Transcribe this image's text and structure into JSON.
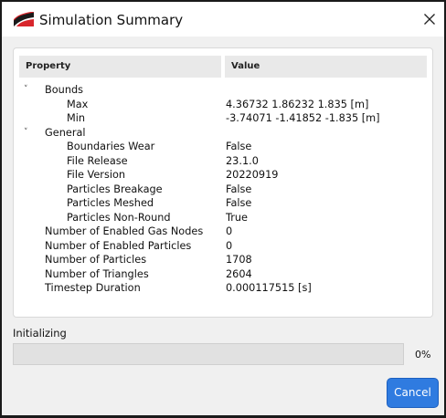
{
  "window": {
    "title": "Simulation Summary",
    "app_icon": "ansys-rocky-logo-icon",
    "close_icon": "close-icon"
  },
  "table": {
    "columns": [
      "Property",
      "Value"
    ],
    "rows": [
      {
        "level": 0,
        "expander": "chevron-down-icon",
        "property": "Bounds",
        "value": ""
      },
      {
        "level": 1,
        "property": "Max",
        "value": "4.36732 1.86232 1.835 [m]"
      },
      {
        "level": 1,
        "property": "Min",
        "value": "-3.74071 -1.41852 -1.835 [m]"
      },
      {
        "level": 0,
        "expander": "chevron-down-icon",
        "property": "General",
        "value": ""
      },
      {
        "level": 1,
        "property": "Boundaries Wear",
        "value": "False"
      },
      {
        "level": 1,
        "property": "File Release",
        "value": "23.1.0"
      },
      {
        "level": 1,
        "property": "File Version",
        "value": "20220919"
      },
      {
        "level": 1,
        "property": "Particles Breakage",
        "value": "False"
      },
      {
        "level": 1,
        "property": "Particles Meshed",
        "value": "False"
      },
      {
        "level": 1,
        "property": "Particles Non-Round",
        "value": "True"
      },
      {
        "level": 0,
        "property": "Number of Enabled Gas Nodes",
        "value": "0"
      },
      {
        "level": 0,
        "property": "Number of Enabled Particles",
        "value": "0"
      },
      {
        "level": 0,
        "property": "Number of Particles",
        "value": "1708"
      },
      {
        "level": 0,
        "property": "Number of Triangles",
        "value": "2604"
      },
      {
        "level": 0,
        "property": "Timestep Duration",
        "value": "0.000117515 [s]"
      }
    ]
  },
  "status": {
    "label": "Initializing",
    "progress": 0,
    "progress_text": "0%"
  },
  "buttons": {
    "cancel_label": "Cancel"
  },
  "colors": {
    "accent": "#2f7be0",
    "icon_red": "#d8262c",
    "icon_dark": "#1a1a1a"
  }
}
